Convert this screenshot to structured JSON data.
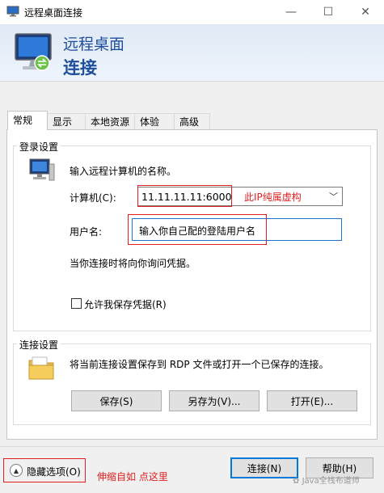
{
  "window": {
    "title": "远程桌面连接",
    "minimize_glyph": "—",
    "maximize_glyph": "☐",
    "close_glyph": "✕"
  },
  "banner": {
    "line1": "远程桌面",
    "line2": "连接",
    "icon": "remote-desktop-monitor-icon"
  },
  "tabs": [
    {
      "label": "常规",
      "active": true
    },
    {
      "label": "显示",
      "active": false
    },
    {
      "label": "本地资源",
      "active": false
    },
    {
      "label": "体验",
      "active": false
    },
    {
      "label": "高级",
      "active": false
    }
  ],
  "login": {
    "group_title": "登录设置",
    "intro": "输入远程计算机的名称。",
    "computer_label": "计算机(C):",
    "computer_value": "11.11.11.11:6000",
    "computer_annotation": "此IP纯属虚构",
    "username_label": "用户名:",
    "username_value": "输入你自己配的登陆用户名",
    "credentials_note": "当你连接时将向你询问凭据。",
    "save_credentials_label": "允许我保存凭据(R)",
    "save_credentials_checked": false
  },
  "connection": {
    "group_title": "连接设置",
    "description": "将当前连接设置保存到 RDP 文件或打开一个已保存的连接。",
    "save_label": "保存(S)",
    "save_as_label": "另存为(V)...",
    "open_label": "打开(E)..."
  },
  "footer": {
    "hide_options_label": "隐藏选项(O)",
    "annotation": "伸缩自如 点这里",
    "connect_label": "连接(N)",
    "help_label": "帮助(H)",
    "watermark": "Java全栈布道师"
  },
  "colors": {
    "accent_blue": "#1f4e9c",
    "annotation_red": "#e02020",
    "focus_blue": "#0078d7"
  }
}
